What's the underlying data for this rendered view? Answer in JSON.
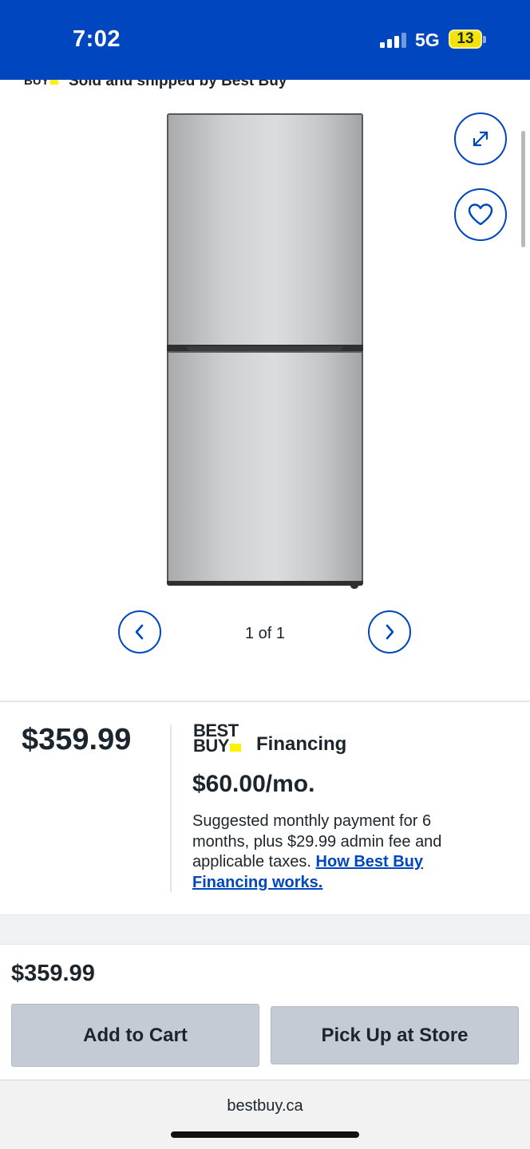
{
  "status_bar": {
    "time": "7:02",
    "network": "5G",
    "battery": "13",
    "color": "#0046be"
  },
  "seller": {
    "logo_text": "BUY",
    "text": "Sold and shipped by Best Buy"
  },
  "gallery": {
    "counter": "1 of 1",
    "image_alt": "Stainless steel bottom-freezer refrigerator"
  },
  "icons": {
    "expand": "expand-icon",
    "wishlist": "heart-icon",
    "prev": "chevron-left-icon",
    "next": "chevron-right-icon"
  },
  "pricing": {
    "price": "$359.99",
    "financing_logo_line1": "BEST",
    "financing_logo_line2": "BUY",
    "financing_label": "Financing",
    "monthly": "$60.00/mo.",
    "description": "Suggested monthly payment for 6 months, plus $29.99 admin fee and applicable taxes.",
    "link": "How Best Buy Financing works."
  },
  "sticky": {
    "price": "$359.99",
    "add_to_cart": "Add to Cart",
    "pickup": "Pick Up at Store"
  },
  "browser": {
    "url": "bestbuy.ca"
  },
  "colors": {
    "brand_blue": "#0046be",
    "brand_yellow": "#fff200",
    "button_gray": "#c5cbd5"
  }
}
